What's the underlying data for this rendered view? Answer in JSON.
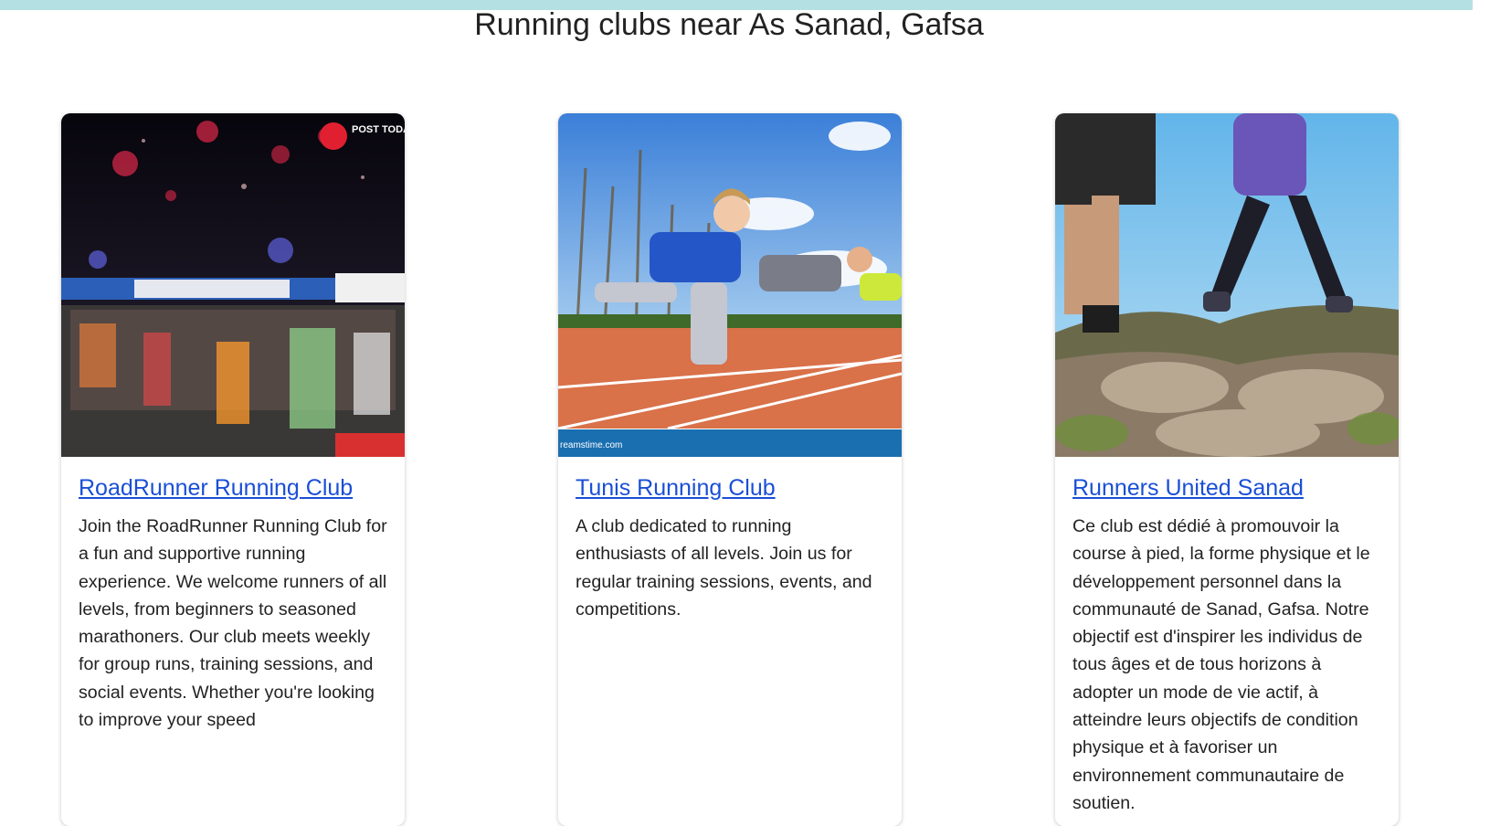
{
  "page": {
    "title": "Running clubs near As Sanad, Gafsa"
  },
  "clubs": [
    {
      "name": "RoadRunner Running Club",
      "description": "Join the RoadRunner Running Club for a fun and supportive running experience. We welcome runners of all levels, from beginners to seasoned marathoners. Our club meets weekly for group runs, training sessions, and social events. Whether you're looking to improve your speed",
      "image_icon": "night-marathon-photo",
      "image_badge": "POST TODAY"
    },
    {
      "name": "Tunis Running Club",
      "description": "A club dedicated to running enthusiasts of all levels. Join us for regular training sessions, events, and competitions.",
      "image_icon": "track-start-photo",
      "image_watermark": "reamstime.com"
    },
    {
      "name": "Runners United Sanad",
      "description": "Ce club est dédié à promouvoir la course à pied, la forme physique et le développement personnel dans la communauté de Sanad, Gafsa. Notre objectif est d'inspirer les individus de tous âges et de tous horizons à adopter un mode de vie actif, à atteindre leurs objectifs de condition physique et à favoriser un environnement communautaire de soutien.",
      "image_icon": "trail-running-photo"
    }
  ],
  "colors": {
    "top_bar": "#b5e0e3",
    "link": "#1a4fd6"
  }
}
